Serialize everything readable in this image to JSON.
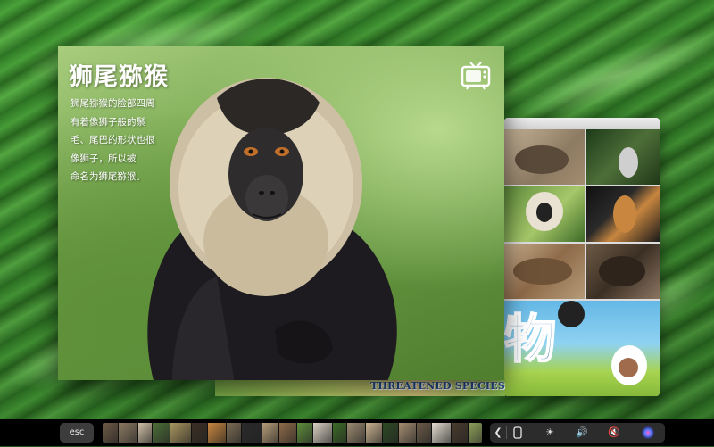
{
  "main_window": {
    "title": "狮尾猕猴",
    "description": "狮尾猕猴的脸部四周\n有着像狮子般的鬃\n毛、尾巴的形状也很\n像狮子，所以被\n命名为狮尾猕猴。",
    "tv_button_icon": "tv-icon"
  },
  "collage_window": {
    "character": "物"
  },
  "banner": {
    "text": "THREATENED SPECIES"
  },
  "touch_bar": {
    "esc_label": "esc",
    "thumbnail_colors": [
      "#6d5a45",
      "#8c7a62",
      "#cfc0a6",
      "#4d6e38",
      "#a8945e",
      "#3b2f24",
      "#c8863f",
      "#7c6d55",
      "#2a2a2a",
      "#b59b78",
      "#8e6a49",
      "#5f8e3d",
      "#d8d0c2",
      "#3d6b27",
      "#9b8a70",
      "#c9b190",
      "#2e4a24",
      "#a48d70",
      "#6b5b48",
      "#e2dccf",
      "#4a3b2d",
      "#8fa05a",
      "#c7b59a"
    ],
    "controls": [
      {
        "icon": "chevron-left-icon",
        "glyph": "❮"
      },
      {
        "icon": "brightness-icon",
        "glyph": "☀"
      },
      {
        "icon": "volume-icon",
        "glyph": "🔊"
      },
      {
        "icon": "mute-icon",
        "glyph": "🔇"
      },
      {
        "icon": "siri-icon",
        "glyph": "◉"
      }
    ]
  }
}
